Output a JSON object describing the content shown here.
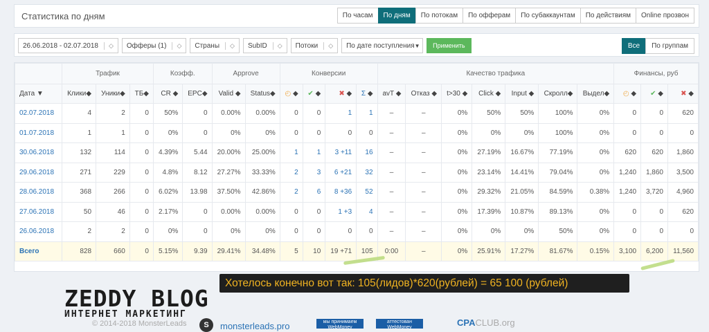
{
  "header": {
    "title": "Статистика по дням",
    "tabs": [
      "По часам",
      "По дням",
      "По потокам",
      "По офферам",
      "По субаккаунтам",
      "По действиям",
      "Online прозвон"
    ]
  },
  "filters": {
    "date": "26.06.2018 - 02.07.2018",
    "offers": "Офферы (1)",
    "countries": "Страны",
    "subid": "SubID",
    "streams": "Потоки",
    "sort": "По дате поступления",
    "apply": "Применить",
    "group_all": "Все",
    "group_by": "По группам"
  },
  "groups": [
    "Трафик",
    "Коэфф.",
    "Approve",
    "Конверсии",
    "Качество трафика",
    "Финансы, руб"
  ],
  "columns": [
    "Дата",
    "Клики",
    "Уники",
    "ТБ",
    "CR",
    "EPC",
    "Valid",
    "Status",
    "",
    "",
    "",
    "Σ",
    "avT",
    "Отказ",
    "t>30",
    "Click",
    "Input",
    "Скролл",
    "Выдел",
    "",
    "",
    ""
  ],
  "rows": [
    [
      "02.07.2018",
      "4",
      "2",
      "0",
      "50%",
      "0",
      "0.00%",
      "0.00%",
      "0",
      "0",
      "1",
      "1",
      "–",
      "–",
      "0%",
      "50%",
      "50%",
      "100%",
      "0%",
      "0",
      "0",
      "620"
    ],
    [
      "01.07.2018",
      "1",
      "1",
      "0",
      "0%",
      "0",
      "0%",
      "0%",
      "0",
      "0",
      "0",
      "0",
      "–",
      "–",
      "0%",
      "0%",
      "0%",
      "100%",
      "0%",
      "0",
      "0",
      "0"
    ],
    [
      "30.06.2018",
      "132",
      "114",
      "0",
      "4.39%",
      "5.44",
      "20.00%",
      "25.00%",
      "1",
      "1",
      "3 +11",
      "16",
      "–",
      "–",
      "0%",
      "27.19%",
      "16.67%",
      "77.19%",
      "0%",
      "620",
      "620",
      "1,860"
    ],
    [
      "29.06.2018",
      "271",
      "229",
      "0",
      "4.8%",
      "8.12",
      "27.27%",
      "33.33%",
      "2",
      "3",
      "6 +21",
      "32",
      "–",
      "–",
      "0%",
      "23.14%",
      "14.41%",
      "79.04%",
      "0%",
      "1,240",
      "1,860",
      "3,500"
    ],
    [
      "28.06.2018",
      "368",
      "266",
      "0",
      "6.02%",
      "13.98",
      "37.50%",
      "42.86%",
      "2",
      "6",
      "8 +36",
      "52",
      "–",
      "–",
      "0%",
      "29.32%",
      "21.05%",
      "84.59%",
      "0.38%",
      "1,240",
      "3,720",
      "4,960"
    ],
    [
      "27.06.2018",
      "50",
      "46",
      "0",
      "2.17%",
      "0",
      "0.00%",
      "0.00%",
      "0",
      "0",
      "1 +3",
      "4",
      "–",
      "–",
      "0%",
      "17.39%",
      "10.87%",
      "89.13%",
      "0%",
      "0",
      "0",
      "620"
    ],
    [
      "26.06.2018",
      "2",
      "2",
      "0",
      "0%",
      "0",
      "0%",
      "0%",
      "0",
      "0",
      "0",
      "0",
      "–",
      "–",
      "0%",
      "0%",
      "0%",
      "50%",
      "0%",
      "0",
      "0",
      "0"
    ]
  ],
  "total": [
    "Всего",
    "828",
    "660",
    "0",
    "5.15%",
    "9.39",
    "29.41%",
    "34.48%",
    "5",
    "10",
    "19 +71",
    "105",
    "0:00",
    "–",
    "0%",
    "25.91%",
    "17.27%",
    "81.67%",
    "0.15%",
    "3,100",
    "6,200",
    "11,560"
  ],
  "banner": "Хотелось конечно вот так:   105(лидов)*620(рублей) = 65 100 (рублей)",
  "footer": {
    "logo_top": "ZEDDY BLOG",
    "logo_bottom": "ИНТЕРНЕТ МАРКЕТИНГ",
    "copyright": "© 2014-2018 MonsterLeads",
    "site": "monsterleads.pro",
    "badge1": "мы принимаем WebMoney",
    "badge2": "аттестован WebMoney",
    "cpa": "CPA",
    "cpa_club": "CLUB.org"
  }
}
